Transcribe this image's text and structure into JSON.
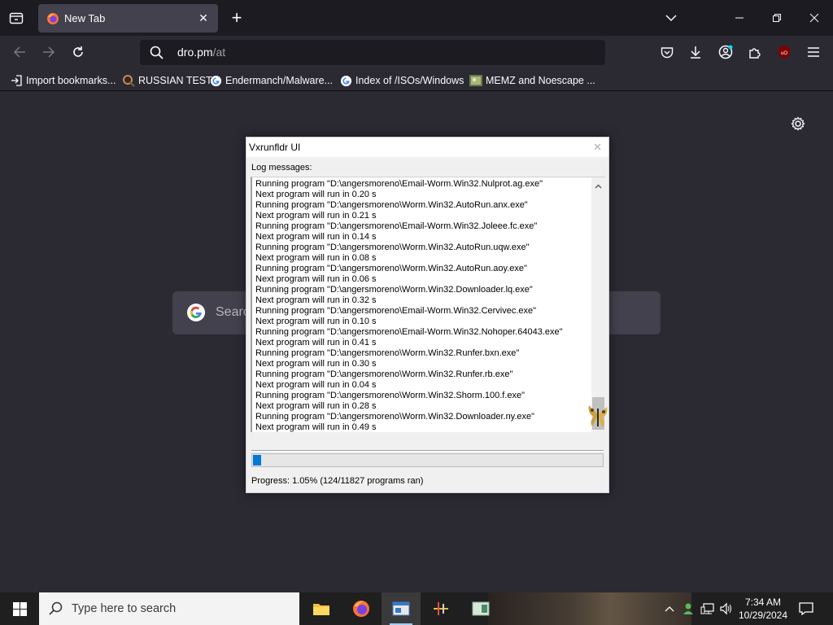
{
  "browser": {
    "active_tab_title": "New Tab",
    "url_host": "dro.pm",
    "url_path": "/at",
    "bookmarks": [
      {
        "label": "Import bookmarks...",
        "icon": "import-icon"
      },
      {
        "label": "RUSSIAN TEST",
        "icon": "magnifier-icon"
      },
      {
        "label": "Endermanch/Malware...",
        "icon": "google-icon"
      },
      {
        "label": "Index of /ISOs/Windows",
        "icon": "google-icon"
      },
      {
        "label": "MEMZ and Noescape ...",
        "icon": "image-icon"
      }
    ],
    "newtab_search_placeholder": "Search"
  },
  "dialog": {
    "title": "Vxrunfldr UI",
    "log_label": "Log messages:",
    "log_lines": [
      "Running program \"D:\\angersmoreno\\Email-Worm.Win32.Nulprot.ag.exe\"",
      "Next program will run in 0.20 s",
      "Running program \"D:\\angersmoreno\\Worm.Win32.AutoRun.anx.exe\"",
      "Next program will run in 0.21 s",
      "Running program \"D:\\angersmoreno\\Email-Worm.Win32.Joleee.fc.exe\"",
      "Next program will run in 0.14 s",
      "Running program \"D:\\angersmoreno\\Worm.Win32.AutoRun.uqw.exe\"",
      "Next program will run in 0.08 s",
      "Running program \"D:\\angersmoreno\\Worm.Win32.AutoRun.aoy.exe\"",
      "Next program will run in 0.06 s",
      "Running program \"D:\\angersmoreno\\Worm.Win32.Downloader.lq.exe\"",
      "Next program will run in 0.32 s",
      "Running program \"D:\\angersmoreno\\Email-Worm.Win32.Cervivec.exe\"",
      "Next program will run in 0.10 s",
      "Running program \"D:\\angersmoreno\\Email-Worm.Win32.Nohoper.64043.exe\"",
      "Next program will run in 0.41 s",
      "Running program \"D:\\angersmoreno\\Worm.Win32.Runfer.bxn.exe\"",
      "Next program will run in 0.30 s",
      "Running program \"D:\\angersmoreno\\Worm.Win32.Runfer.rb.exe\"",
      "Next program will run in 0.04 s",
      "Running program \"D:\\angersmoreno\\Worm.Win32.Shorm.100.f.exe\"",
      "Next program will run in 0.28 s",
      "Running program \"D:\\angersmoreno\\Worm.Win32.Downloader.ny.exe\"",
      "Next program will run in 0.49 s"
    ],
    "progress_fraction": 0.0105,
    "progress_text": "Progress: 1.05% (124/11827 programs ran)"
  },
  "taskbar": {
    "search_placeholder": "Type here to search",
    "time": "7:34 AM",
    "date": "10/29/2024"
  },
  "colors": {
    "accent": "#0078d7",
    "browser_bg": "#2b2a33",
    "tabstrip_bg": "#1c1b22"
  }
}
